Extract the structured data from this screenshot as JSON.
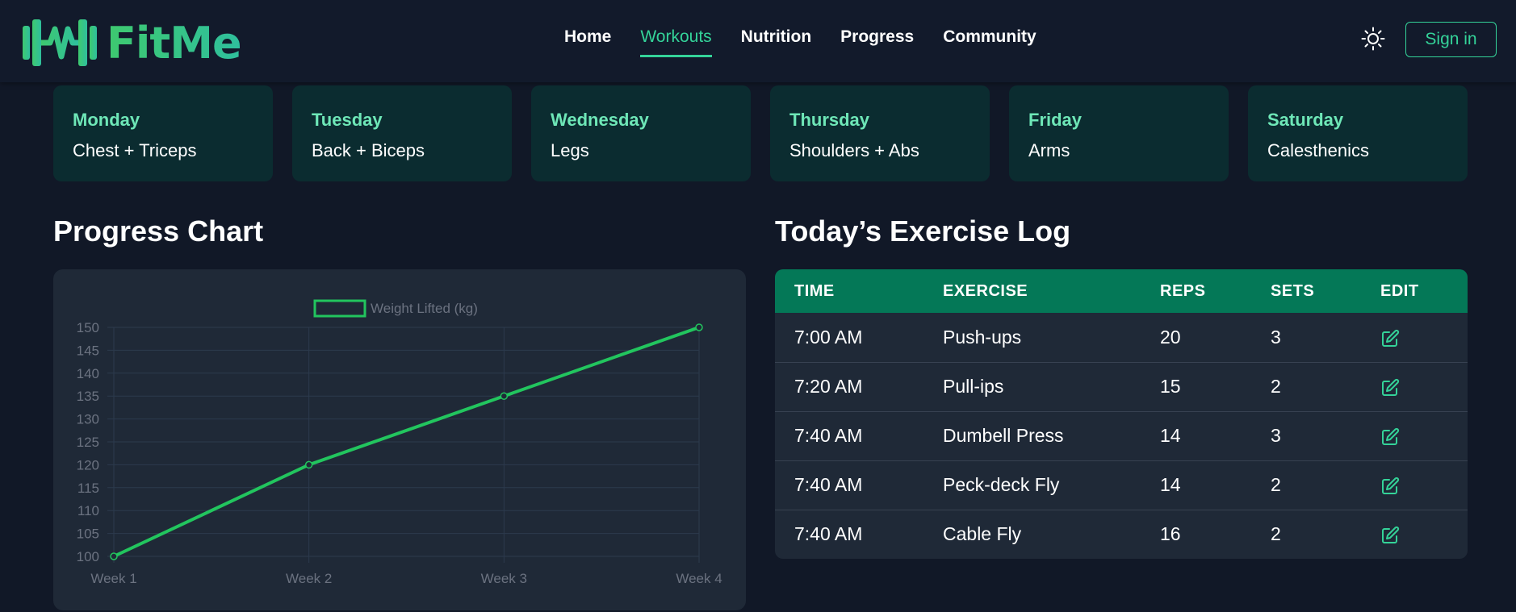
{
  "header": {
    "brand": "FitMe",
    "nav": [
      {
        "label": "Home",
        "active": false
      },
      {
        "label": "Workouts",
        "active": true
      },
      {
        "label": "Nutrition",
        "active": false
      },
      {
        "label": "Progress",
        "active": false
      },
      {
        "label": "Community",
        "active": false
      }
    ],
    "theme_icon": "sun-icon",
    "signin_label": "Sign in"
  },
  "days": [
    {
      "day": "Monday",
      "focus": "Chest + Triceps"
    },
    {
      "day": "Tuesday",
      "focus": "Back + Biceps"
    },
    {
      "day": "Wednesday",
      "focus": "Legs"
    },
    {
      "day": "Thursday",
      "focus": "Shoulders + Abs"
    },
    {
      "day": "Friday",
      "focus": "Arms"
    },
    {
      "day": "Saturday",
      "focus": "Calesthenics"
    }
  ],
  "progress": {
    "title": "Progress Chart"
  },
  "log": {
    "title": "Today’s Exercise Log",
    "columns": [
      "TIME",
      "EXERCISE",
      "REPS",
      "SETS",
      "EDIT"
    ],
    "rows": [
      {
        "time": "7:00 AM",
        "exercise": "Push-ups",
        "reps": "20",
        "sets": "3"
      },
      {
        "time": "7:20 AM",
        "exercise": "Pull-ips",
        "reps": "15",
        "sets": "2"
      },
      {
        "time": "7:40 AM",
        "exercise": "Dumbell Press",
        "reps": "14",
        "sets": "3"
      },
      {
        "time": "7:40 AM",
        "exercise": "Peck-deck Fly",
        "reps": "14",
        "sets": "2"
      },
      {
        "time": "7:40 AM",
        "exercise": "Cable Fly",
        "reps": "16",
        "sets": "2"
      }
    ],
    "edit_icon": "edit-icon"
  },
  "colors": {
    "accent": "#34d399",
    "line": "#22c55e",
    "card": "#0b2c30",
    "table_header": "#047857"
  },
  "chart_data": {
    "type": "line",
    "categories": [
      "Week 1",
      "Week 2",
      "Week 3",
      "Week 4"
    ],
    "series": [
      {
        "name": "Weight Lifted (kg)",
        "values": [
          100,
          120,
          135,
          150
        ]
      }
    ],
    "yticks": [
      100,
      105,
      110,
      115,
      120,
      125,
      130,
      135,
      140,
      145,
      150
    ],
    "ylim": [
      100,
      150
    ],
    "legend": "top-center",
    "grid": true
  }
}
